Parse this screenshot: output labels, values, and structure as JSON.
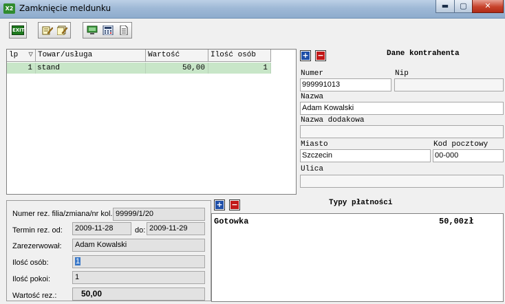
{
  "window": {
    "logo": "X2",
    "title": "Zamknięcie meldunku",
    "minimize": "▬",
    "maximize": "▢",
    "close": "✕"
  },
  "toolbar": {
    "exit_label": "EXIT",
    "icons": [
      "exit-icon",
      "edit-note-icon",
      "edit-notes-icon",
      "computer-icon",
      "calculator-icon",
      "document-icon"
    ]
  },
  "grid": {
    "columns": [
      "lp",
      "Towar/usługa",
      "Wartość",
      "Ilość osób"
    ],
    "sort_glyph": "▽",
    "rows": [
      {
        "lp": "1",
        "item": "stand",
        "value": "50,00",
        "persons": "1"
      }
    ]
  },
  "contractor": {
    "title": "Dane kontrahenta",
    "numer_label": "Numer",
    "numer": "999991013",
    "nip_label": "Nip",
    "nip": "",
    "nazwa_label": "Nazwa",
    "nazwa": "Adam Kowalski",
    "nazwa_dod_label": "Nazwa dodakowa",
    "nazwa_dod": "",
    "miasto_label": "Miasto",
    "miasto": "Szczecin",
    "kod_label": "Kod pocztowy",
    "kod": "00-000",
    "ulica_label": "Ulica",
    "ulica": ""
  },
  "reservation": {
    "numer_label": "Numer rez. filia/zmiana/nr kol.:",
    "numer": "99999/1/20",
    "termin_label": "Termin rez. od:",
    "od": "2009-11-28",
    "do_label": "do:",
    "do": "2009-11-29",
    "zarez_label": "Zarezerwował:",
    "zarez": "Adam  Kowalski",
    "osob_label": "Ilość osób:",
    "osob": "1",
    "pokoi_label": "Ilość pokoi:",
    "pokoi": "1",
    "wartosc_label": "Wartość rez.:",
    "wartosc": "50,00"
  },
  "payments": {
    "title": "Typy płatności",
    "rows": [
      {
        "type": "Gotowka",
        "amount": "50,00zł"
      }
    ]
  },
  "colors": {
    "selected_row": "#c8e6c8",
    "plus_button": "#1f4fa8",
    "minus_button": "#c21818"
  }
}
